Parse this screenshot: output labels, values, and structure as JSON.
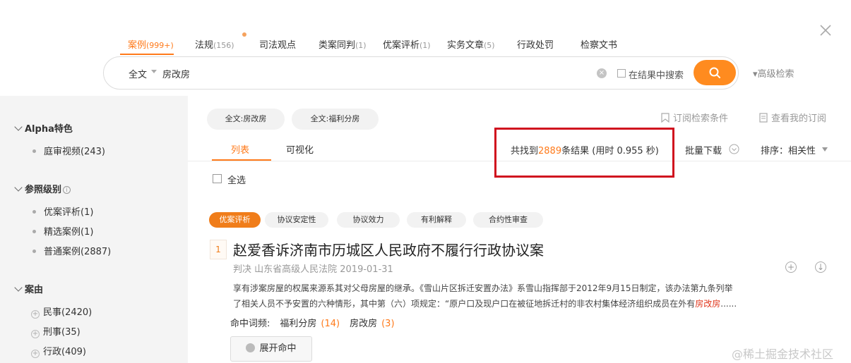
{
  "tabs": [
    {
      "label": "案例",
      "count": "(999+)",
      "active": true
    },
    {
      "label": "法规",
      "count": "(156)"
    },
    {
      "label": "司法观点",
      "count": ""
    },
    {
      "label": "类案同判",
      "count": "(1)"
    },
    {
      "label": "优案评析",
      "count": "(1)"
    },
    {
      "label": "实务文章",
      "count": "(5)"
    },
    {
      "label": "行政处罚",
      "count": ""
    },
    {
      "label": "检察文书",
      "count": ""
    }
  ],
  "search": {
    "scope": "全文",
    "query": "房改房",
    "clear_symbol": "×",
    "in_result_label": "在结果中搜索",
    "advanced": "▾高级检索"
  },
  "filters": {
    "sections": [
      {
        "title": "Alpha特色",
        "items": [
          {
            "label": "庭审视频(243)"
          }
        ]
      },
      {
        "title": "参照级别",
        "items": [
          {
            "label": "优案评析(1)"
          },
          {
            "label": "精选案例(1)"
          },
          {
            "label": "普通案例(2887)"
          }
        ]
      },
      {
        "title": "案由",
        "items": [
          {
            "label": "民事(2420)"
          },
          {
            "label": "刑事(35)"
          },
          {
            "label": "行政(409)"
          }
        ]
      }
    ],
    "info_symbol": "i",
    "plus_symbol": "+"
  },
  "chips": [
    "全文:房改房",
    "全文:福利分房"
  ],
  "subscribe": {
    "save": "订阅检索条件",
    "view": "查看我的订阅"
  },
  "view_tabs": [
    "列表",
    "可视化"
  ],
  "results_summary": {
    "prefix": "共找到",
    "count": "2889",
    "suffix": "条结果 (用时 0.955 秒)"
  },
  "toolbar": {
    "batch_download": "批量下载",
    "sort_label": "排序：相关性"
  },
  "select_all": "全选",
  "result": {
    "index": "1",
    "tags": [
      "优案评析",
      "协议安定性",
      "协议效力",
      "有利解释",
      "合约性审查"
    ],
    "title": "赵爱香诉济南市历城区人民政府不履行行政协议案",
    "meta": "判决  山东省高级人民法院  2019-01-31",
    "snippet_line1": "享有涉案房屋的权属来源系其对父母房屋的继承。《雪山片区拆迁安置办法》系雪山指挥部于2012年9月15日制定，该办法第九条列举",
    "snippet_line2": "了相关人员不予安置的六种情形，其中第（六）项规定：“原户口及现户口在被征地拆迁村的非农村集体经济组织成员在外有",
    "snippet_highlight": "房改房",
    "snippet_tail": "......",
    "hits_label": "命中词频:",
    "hits": [
      {
        "word": "福利分房",
        "count": "(14)"
      },
      {
        "word": "房改房",
        "count": "(3)"
      }
    ],
    "expand_label": "展开命中",
    "add_symbol": "+",
    "download_symbol": "↓"
  },
  "watermark": "@稀土掘金技术社区",
  "colors": {
    "accent": "#ff7a1a",
    "highlight_box": "#d0101e"
  }
}
